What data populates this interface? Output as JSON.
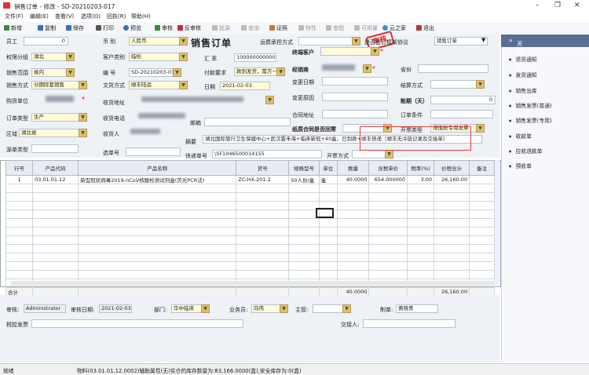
{
  "window": {
    "title": "销售订单 - 修改 - SD-20210203-017"
  },
  "menu": [
    "文件(F)",
    "编辑(E)",
    "查看(V)",
    "选项(O)",
    "回执(R)",
    "帮助(H)"
  ],
  "toolbar": [
    {
      "label": "新增",
      "icon": "add-icon",
      "color": "#3a8a3a",
      "enabled": true
    },
    {
      "label": "复制",
      "icon": "copy-icon",
      "color": "#3a6fbf",
      "enabled": true
    },
    {
      "label": "保存",
      "icon": "save-icon",
      "color": "#3a6fbf",
      "enabled": true
    },
    {
      "label": "打印",
      "icon": "print-icon",
      "color": "#555555",
      "enabled": true
    },
    {
      "label": "预览",
      "icon": "preview-icon",
      "color": "#3a6fbf",
      "enabled": true
    },
    {
      "label": "审核",
      "icon": "approve-icon",
      "color": "#3a8a3a",
      "enabled": true
    },
    {
      "label": "反审核",
      "icon": "unapprove-icon",
      "color": "#c03030",
      "enabled": true
    },
    {
      "label": "批录",
      "icon": "batch-icon",
      "color": "#999999",
      "enabled": false
    },
    {
      "label": "查询",
      "icon": "query-icon",
      "color": "#999999",
      "enabled": false
    },
    {
      "label": "证照",
      "icon": "license-icon",
      "color": "#c08030",
      "enabled": true
    },
    {
      "label": "特性",
      "icon": "feature-icon",
      "color": "#999999",
      "enabled": false
    },
    {
      "label": "查图",
      "icon": "image-icon",
      "color": "#999999",
      "enabled": false
    },
    {
      "label": "可用量",
      "icon": "stock-icon",
      "color": "#999999",
      "enabled": false
    },
    {
      "label": "云之家",
      "icon": "cloud-icon",
      "color": "#3a8fd0",
      "enabled": true
    },
    {
      "label": "退出",
      "icon": "exit-icon",
      "color": "#c03030",
      "enabled": true
    }
  ],
  "form": {
    "title": "销售订单",
    "stamp": "审核",
    "staff_label": "员工",
    "staff_value": "0",
    "currency_label": "币 别",
    "currency_value": "人民币",
    "transport_label": "运费承担方式",
    "signed_label": "是否签订框架协议",
    "doctype_value": "销售订单",
    "perm_label": "权限分组",
    "perm_value": "湖北",
    "custtype_label": "客户类别",
    "custtype_value": "临检",
    "rate_label": "汇 率",
    "rate_value": "1000000000000",
    "terminal_label": "终端客户",
    "range_label": "销售范围",
    "range_value": "省内",
    "number_label": "编 号",
    "number_value": "SD-20210203-017",
    "payreq_label": "付款要求",
    "payreq_value": "款到发货，需方一次100%付",
    "dealer_label": "经销商",
    "province_label": "省份",
    "method_label": "销售方式",
    "method_value": "分期际套销售",
    "courier_label": "文货方式",
    "courier_value": "顺丰陆运",
    "date_label": "日期",
    "date_value": "2021-02-03",
    "changedate_label": "变更日期",
    "settle_label": "结算方式",
    "buyer_label": "购货单位",
    "receiver_label": "收货地址",
    "changereason_label": "变更原因",
    "term_label": "账期（天）",
    "term_value": "0",
    "ordertype_label": "订单类型",
    "ordertype_value": "生产",
    "phone_label": "收货电话",
    "contract_addr_label": "合同地址",
    "ordercond_label": "订单条件",
    "region_label": "区域",
    "region_value": "湖北省",
    "consignee_label": "收货人",
    "mail_label": "邮箱",
    "paper_contract_label": "纸质合同是否回寄",
    "invoice_type_label": "开票类型",
    "invoice_type_value": "增值税专用发票",
    "doc_label": "源单类型",
    "summary_label": "摘要",
    "summary_value": "湖北国际旅行卫生保健中心+武汉雷禾海+临床新冠+40盒，已到款+顺丰快递（顺丰无冷链记录及交接单）",
    "selnum_label": "选单号",
    "express_label": "快递单号",
    "express_value": "\\SF1046500014155",
    "invoice_method_label": "开票方式"
  },
  "table": {
    "headers": [
      "行号",
      "产品代码",
      "产品名称",
      "货号",
      "规格型号",
      "单位",
      "数量",
      "含税单价",
      "税率(%)",
      "价税合计",
      "备注"
    ],
    "rows": [
      [
        "1",
        "03.01.01.12",
        "新型冠状病毒2019-nCoV核酸检测试剂盒(荧光PCR法)",
        "ZC-HX-201-2",
        "50人份/盒",
        "盒",
        "40.0000",
        "654.000000",
        "3.00",
        "26,160.00",
        ""
      ]
    ],
    "sum_label": "合计",
    "sum_qty": "40.0000",
    "sum_total": "26,160.00"
  },
  "footer": {
    "auditor_label": "审核:",
    "auditor_value": "Administrator",
    "auditdate_label": "审核日期:",
    "auditdate_value": "2021-02-03",
    "dept_label": "部门:",
    "dept_value": "华中临床",
    "salesman_label": "业务员:",
    "salesman_value": "向伟",
    "supervisor_label": "主管:",
    "maker_label": "制单:",
    "maker_value": "黄晓青",
    "taxinv_label": "税控发票",
    "transfer_label": "交接人:"
  },
  "sidebar": {
    "title": "关联信息",
    "items": [
      "退货通知",
      "发货通知",
      "销售出库",
      "销售发票(普通)",
      "销售发票(专用)",
      "收款单",
      "应收退款单",
      "预收单"
    ]
  },
  "status": {
    "left": "就绪",
    "message": "物料(03.01.01.12.0002)辅助属性(无)实仓的库存数量为:83,166.0000(盒),安全库存为:0(盒)"
  }
}
